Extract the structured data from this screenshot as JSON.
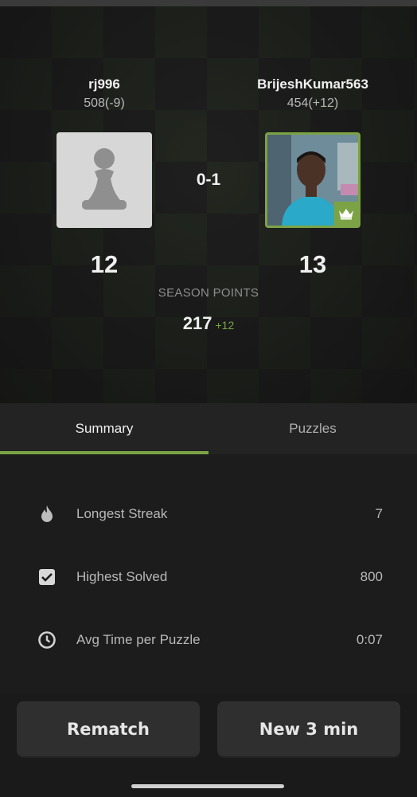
{
  "players": {
    "left": {
      "name": "rj996",
      "rating": "508(-9)",
      "score": "12"
    },
    "right": {
      "name": "BrijeshKumar563",
      "rating": "454(+12)",
      "score": "13"
    }
  },
  "result": "0-1",
  "season": {
    "label": "SEASON POINTS",
    "value": "217",
    "delta": "+12"
  },
  "tabs": [
    {
      "label": "Summary",
      "active": true
    },
    {
      "label": "Puzzles",
      "active": false
    }
  ],
  "stats": [
    {
      "icon": "flame-icon",
      "label": "Longest Streak",
      "value": "7"
    },
    {
      "icon": "checkbox-icon",
      "label": "Highest Solved",
      "value": "800"
    },
    {
      "icon": "clock-icon",
      "label": "Avg Time per Puzzle",
      "value": "0:07"
    }
  ],
  "buttons": {
    "rematch": "Rematch",
    "new_game": "New 3 min"
  },
  "colors": {
    "accent": "#7ba345",
    "background": "#1a1a1a",
    "button": "#2f2f2f"
  }
}
